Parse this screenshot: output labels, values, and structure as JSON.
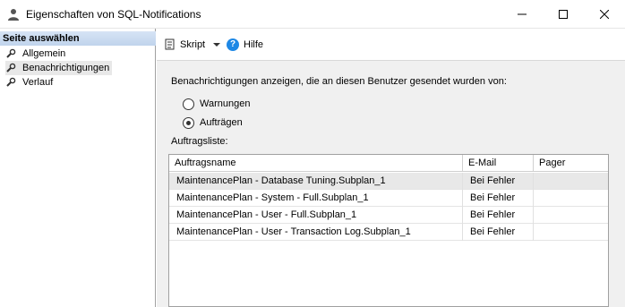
{
  "window": {
    "title": "Eigenschaften von SQL-Notifications"
  },
  "sidebar": {
    "header": "Seite auswählen",
    "items": [
      {
        "label": "Allgemein",
        "icon": "wrench-icon"
      },
      {
        "label": "Benachrichtigungen",
        "icon": "wrench-icon"
      },
      {
        "label": "Verlauf",
        "icon": "wrench-icon"
      }
    ]
  },
  "toolbar": {
    "script_label": "Skript",
    "help_label": "Hilfe"
  },
  "main": {
    "description": "Benachrichtigungen anzeigen, die an diesen Benutzer gesendet wurden von:",
    "radio_warnings": "Warnungen",
    "radio_jobs": "Aufträgen",
    "list_label": "Auftragsliste:"
  },
  "table": {
    "columns": [
      "Auftragsname",
      "E-Mail",
      "Pager"
    ],
    "rows": [
      {
        "name": "MaintenancePlan - Database Tuning.Subplan_1",
        "email": "Bei Fehler",
        "pager": ""
      },
      {
        "name": "MaintenancePlan - System - Full.Subplan_1",
        "email": "Bei Fehler",
        "pager": ""
      },
      {
        "name": "MaintenancePlan - User - Full.Subplan_1",
        "email": "Bei Fehler",
        "pager": ""
      },
      {
        "name": "MaintenancePlan - User - Transaction Log.Subplan_1",
        "email": "Bei Fehler",
        "pager": ""
      }
    ]
  }
}
